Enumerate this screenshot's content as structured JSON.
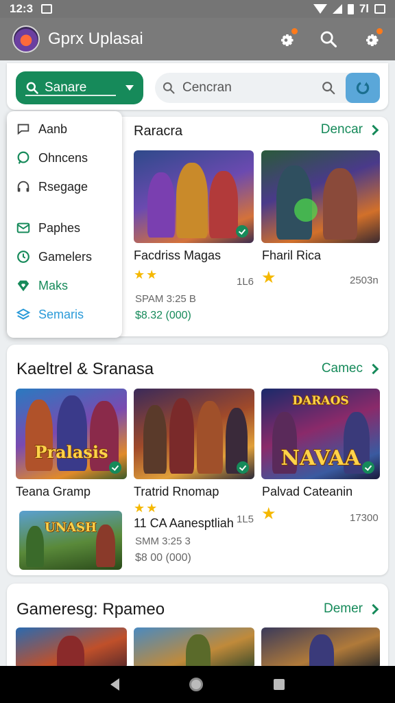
{
  "status": {
    "time": "12:3",
    "right": "7l"
  },
  "appbar": {
    "title": "Gprx Uplasai"
  },
  "search": {
    "dropdown_label": "Sanare",
    "placeholder": "Cencran"
  },
  "menu": {
    "items": [
      {
        "label": "Aanb",
        "icon": "chat-bubble-icon",
        "color": "#444"
      },
      {
        "label": "Ohncens",
        "icon": "speech-bubble-icon",
        "color": "#168a5a"
      },
      {
        "label": "Rsegage",
        "icon": "headset-icon",
        "color": "#444"
      },
      {
        "label": "Paphes",
        "icon": "mail-icon",
        "color": "#168a5a"
      },
      {
        "label": "Gamelers",
        "icon": "clock-icon",
        "color": "#168a5a"
      },
      {
        "label": "Maks",
        "icon": "heart-shield-icon",
        "color": "#168a5a"
      },
      {
        "label": "Semaris",
        "icon": "stack-icon",
        "color": "#2a9ad8"
      }
    ]
  },
  "section1": {
    "title": "Raracra",
    "link": "Dencar",
    "games": [
      {
        "title": "Facdriss Magas",
        "rating": "★★",
        "count": "1L6",
        "meta": "SPAM 3:25 B",
        "price": "$8.32 (000)"
      },
      {
        "title": "Fharil Rica",
        "rating": "★",
        "count": "2503n"
      }
    ]
  },
  "section2": {
    "title": "Kaeltrel & Sranasa",
    "link": "Camec",
    "games": [
      {
        "title": "Teana Gramp",
        "logo": "Pralasis"
      },
      {
        "title": "Tratrid Rnomap"
      },
      {
        "title": "Palvad Cateanin",
        "logo": "NAVAA",
        "logo_top": "DARAOS",
        "rating": "★",
        "count": "17300"
      }
    ],
    "featured": {
      "logo": "UNASH",
      "title": "11 CA Aanesptliah",
      "rating": "★★",
      "count": "1L5",
      "meta": "SMM 3:25 3",
      "price": "$8 00 (000)"
    }
  },
  "section3": {
    "title": "Gameresg: Rpameo",
    "link": "Demer"
  },
  "colors": {
    "accent": "#168a5a",
    "appbar": "#7a7a7a",
    "star": "#f5b800"
  }
}
